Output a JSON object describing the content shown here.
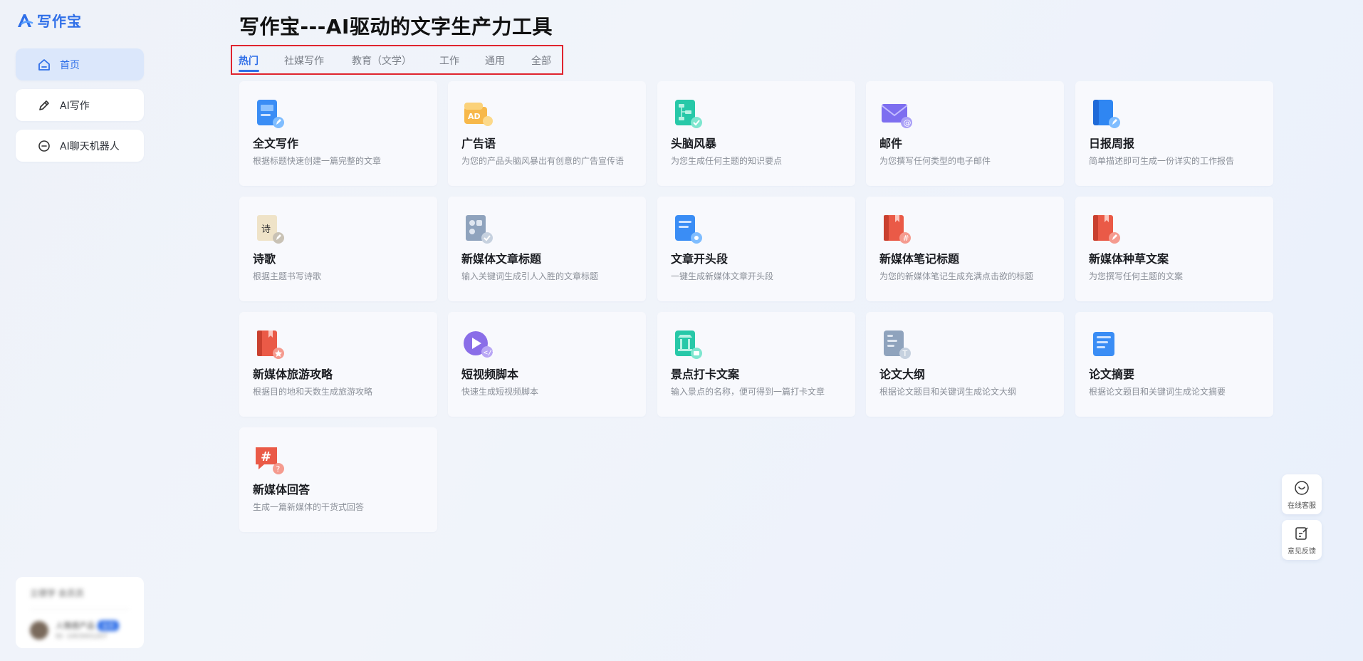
{
  "app": {
    "logo_text": "写作宝",
    "brand_color": "#2f6fe8"
  },
  "sidebar": {
    "items": [
      {
        "label": "首页",
        "icon": "home-icon",
        "active": true
      },
      {
        "label": "AI写作",
        "icon": "pencil-icon",
        "active": false
      },
      {
        "label": "AI聊天机器人",
        "icon": "chat-icon",
        "active": false
      }
    ]
  },
  "user": {
    "line1": "立德学 会员员",
    "name": "人情感产品",
    "badge": "会员",
    "sub": "ID: 1003001207"
  },
  "main": {
    "title": "写作宝---AI驱动的文字生产力工具",
    "tabs": [
      {
        "label": "热门",
        "active": true
      },
      {
        "label": "社媒写作",
        "active": false
      },
      {
        "label": "教育（文学）",
        "active": false
      },
      {
        "label": "工作",
        "active": false
      },
      {
        "label": "通用",
        "active": false
      },
      {
        "label": "全部",
        "active": false
      }
    ],
    "cards": [
      {
        "title": "全文写作",
        "desc": "根据标题快速创建一篇完整的文章",
        "icon": "document-edit-icon"
      },
      {
        "title": "广告语",
        "desc": "为您的产品头脑风暴出有创意的广告宣传语",
        "icon": "ad-icon"
      },
      {
        "title": "头脑风暴",
        "desc": "为您生成任何主题的知识要点",
        "icon": "mindmap-icon"
      },
      {
        "title": "邮件",
        "desc": "为您撰写任何类型的电子邮件",
        "icon": "mail-icon"
      },
      {
        "title": "日报周报",
        "desc": "简单描述即可生成一份详实的工作报告",
        "icon": "report-icon"
      },
      {
        "title": "诗歌",
        "desc": "根据主题书写诗歌",
        "icon": "poem-icon"
      },
      {
        "title": "新媒体文章标题",
        "desc": "输入关键词生成引人入胜的文章标题",
        "icon": "headline-icon"
      },
      {
        "title": "文章开头段",
        "desc": "一键生成新媒体文章开头段",
        "icon": "opening-icon"
      },
      {
        "title": "新媒体笔记标题",
        "desc": "为您的新媒体笔记生成充满点击欲的标题",
        "icon": "note-icon"
      },
      {
        "title": "新媒体种草文案",
        "desc": "为您撰写任何主题的文案",
        "icon": "recommend-icon"
      },
      {
        "title": "新媒体旅游攻略",
        "desc": "根据目的地和天数生成旅游攻略",
        "icon": "travel-icon"
      },
      {
        "title": "短视频脚本",
        "desc": "快速生成短视频脚本",
        "icon": "video-icon"
      },
      {
        "title": "景点打卡文案",
        "desc": "输入景点的名称，便可得到一篇打卡文章",
        "icon": "landmark-icon"
      },
      {
        "title": "论文大纲",
        "desc": "根据论文题目和关键词生成论文大纲",
        "icon": "outline-icon"
      },
      {
        "title": "论文摘要",
        "desc": "根据论文题目和关键词生成论文摘要",
        "icon": "abstract-icon"
      },
      {
        "title": "新媒体回答",
        "desc": "生成一篇新媒体的干货式回答",
        "icon": "qa-icon"
      }
    ]
  },
  "float": {
    "service": "在线客服",
    "feedback": "意见反馈"
  }
}
